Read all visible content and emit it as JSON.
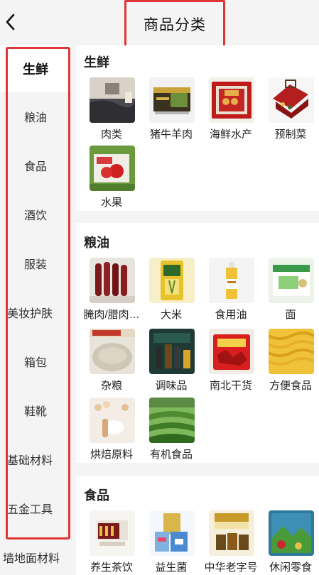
{
  "header": {
    "title": "商品分类",
    "back_icon": "chevron-left-icon"
  },
  "sidebar": {
    "items": [
      {
        "label": "生鲜",
        "active": true
      },
      {
        "label": "粮油"
      },
      {
        "label": "食品"
      },
      {
        "label": "酒饮"
      },
      {
        "label": "服装"
      },
      {
        "label": "美妆护肤"
      },
      {
        "label": "箱包"
      },
      {
        "label": "鞋靴"
      },
      {
        "label": "基础材料"
      },
      {
        "label": "五金工具"
      },
      {
        "label": "墙地面材料"
      }
    ]
  },
  "sections": [
    {
      "title": "生鲜",
      "items": [
        {
          "label": "肉类",
          "icon": "bedroom-photo"
        },
        {
          "label": "猪牛羊肉",
          "icon": "gift-box-photo"
        },
        {
          "label": "海鲜水产",
          "icon": "red-gift-box-photo"
        },
        {
          "label": "预制菜",
          "icon": "red-case-photo"
        },
        {
          "label": "水果",
          "icon": "apple-box-photo"
        }
      ]
    },
    {
      "title": "粮油",
      "items": [
        {
          "label": "腌肉/腊肉…",
          "icon": "sausage-photo"
        },
        {
          "label": "大米",
          "icon": "rice-bag-photo"
        },
        {
          "label": "食用油",
          "icon": "oil-bottle-photo"
        },
        {
          "label": "面",
          "icon": "noodle-box-photo"
        },
        {
          "label": "杂粮",
          "icon": "flour-photo"
        },
        {
          "label": "调味品",
          "icon": "seasoning-photo"
        },
        {
          "label": "南北干货",
          "icon": "dried-chili-photo"
        },
        {
          "label": "方便食品",
          "icon": "instant-noodle-photo"
        },
        {
          "label": "烘焙原料",
          "icon": "baking-photo"
        },
        {
          "label": "有机食品",
          "icon": "tea-field-photo"
        }
      ]
    },
    {
      "title": "食品",
      "items": [
        {
          "label": "养生茶饮",
          "icon": "tea-box-photo"
        },
        {
          "label": "益生菌",
          "icon": "probiotic-photo"
        },
        {
          "label": "中华老字号",
          "icon": "honey-jar-photo"
        },
        {
          "label": "休闲零食",
          "icon": "snack-bag-photo"
        }
      ]
    }
  ],
  "colors": {
    "highlight": "#e03535",
    "background": "#f4f4f4"
  }
}
